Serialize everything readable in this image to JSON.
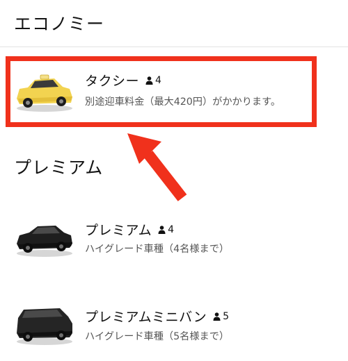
{
  "sections": {
    "economy": {
      "title": "エコノミー",
      "rides": [
        {
          "name": "タクシー",
          "capacity": "4",
          "description": "別途迎車料金（最大420円）がかかります。",
          "car_color": "#f2d350",
          "car_icon": "taxi-car-icon"
        }
      ]
    },
    "premium": {
      "title": "プレミアム",
      "rides": [
        {
          "name": "プレミアム",
          "capacity": "4",
          "description": "ハイグレード車種（4名様まで）",
          "car_color": "#1e1e1e",
          "car_icon": "sedan-car-icon"
        },
        {
          "name": "プレミアムミニバン",
          "capacity": "5",
          "description": "ハイグレード車種（5名様まで）",
          "car_color": "#252525",
          "car_icon": "minivan-car-icon"
        }
      ]
    }
  },
  "annotation": {
    "color": "#f0311c",
    "icon": "red-arrow-icon"
  },
  "icons": {
    "capacity": "person-icon"
  }
}
